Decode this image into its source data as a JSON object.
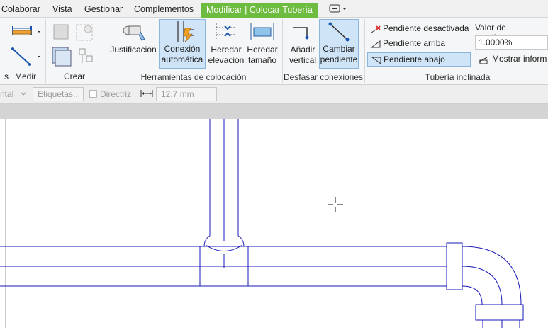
{
  "tabs": [
    "Colaborar",
    "Vista",
    "Gestionar",
    "Complementos",
    "Modificar | Colocar Tubería"
  ],
  "ribbon": {
    "medir_label": "Medir",
    "crear_label": "Crear",
    "justificacion": "Justificación",
    "conexion_l1": "Conexión",
    "conexion_l2": "automática",
    "heredar_elev_l1": "Heredar",
    "heredar_elev_l2": "elevación",
    "heredar_tam_l1": "Heredar",
    "heredar_tam_l2": "tamaño",
    "anadir_l1": "Añadir",
    "anadir_l2": "vertical",
    "cambiar_l1": "Cambiar",
    "cambiar_l2": "pendiente",
    "panel_herramientas": "Herramientas de colocación",
    "panel_desfasar": "Desfasar conexiones",
    "panel_tuberia": "Tubería inclinada",
    "pendiente_desactivada": "Pendiente desactivada",
    "pendiente_arriba": "Pendiente arriba",
    "pendiente_abajo": "Pendiente abajo",
    "valor_label": "Valor de pendiente:",
    "valor": "1.0000%",
    "mostrar": "Mostrar inform",
    "left_cut_label": "s"
  },
  "options": {
    "left_cut": "ntal",
    "etiquetas": "Etiquetas...",
    "directriz": "Directriz",
    "distance": "12.7 mm"
  },
  "colors": {
    "accent": "#6dbb3f",
    "pipe": "#1a1ab8",
    "selected": "#cfe4f7"
  }
}
